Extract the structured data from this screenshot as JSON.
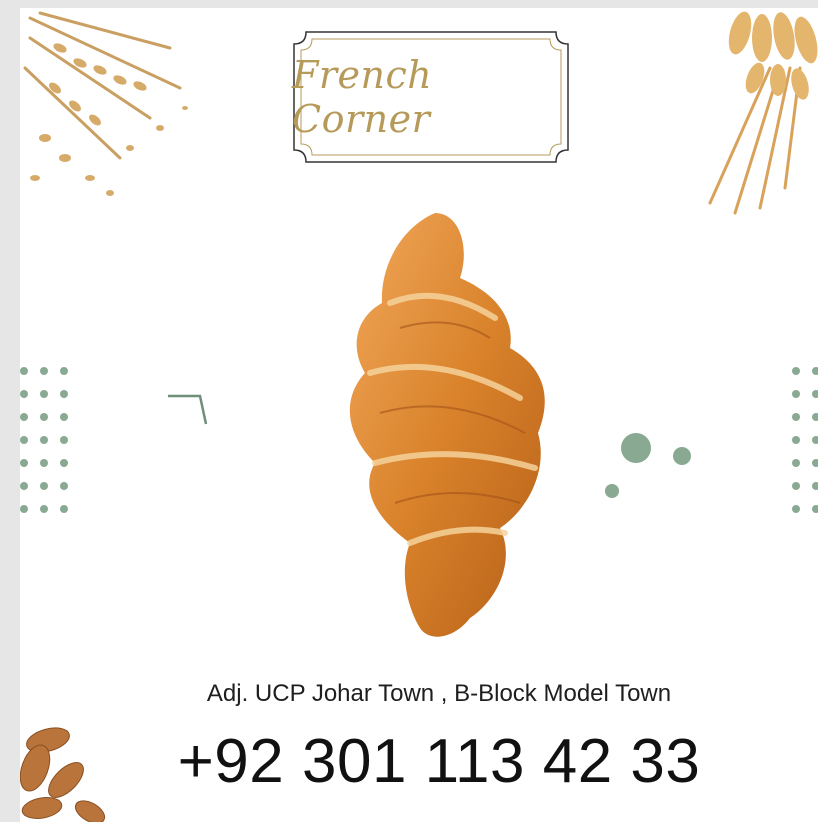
{
  "brand": {
    "logo_text": "French Corner"
  },
  "contact": {
    "address": "Adj. UCP Johar Town , B-Block Model Town",
    "phone": "+92 301 113 42 33"
  },
  "colors": {
    "background": "#ffffff",
    "accent_green": "#8aa993",
    "logo_gold": "#b69a5a",
    "croissant": "#d9822b"
  },
  "decorations": {
    "top_left": "wheat-grain-icon",
    "top_right": "wheat-stalk-icon",
    "bottom_left": "almond-icon",
    "center": "croissant-image",
    "side_pattern": "dot-grid-pattern"
  }
}
